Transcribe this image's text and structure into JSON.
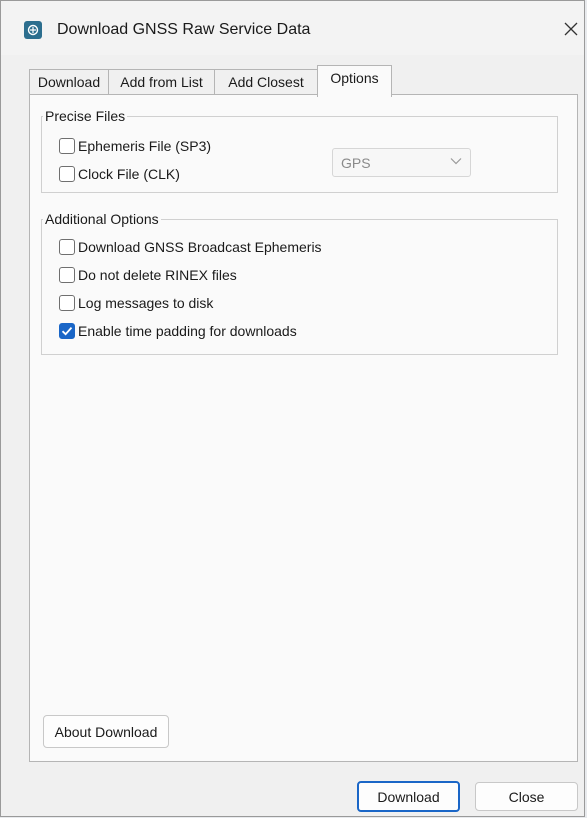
{
  "window": {
    "title": "Download GNSS Raw Service Data",
    "app_icon": "gnss-app-icon",
    "close_icon": "close-icon"
  },
  "tabs": [
    {
      "label": "Download",
      "active": false
    },
    {
      "label": "Add from List",
      "active": false
    },
    {
      "label": "Add Closest",
      "active": false
    },
    {
      "label": "Options",
      "active": true
    }
  ],
  "precise_files": {
    "legend": "Precise Files",
    "ephemeris": {
      "label": "Ephemeris File (SP3)",
      "checked": false
    },
    "clock": {
      "label": "Clock File (CLK)",
      "checked": false
    },
    "constellation": {
      "value": "GPS",
      "enabled": false
    }
  },
  "additional_options": {
    "legend": "Additional Options",
    "items": [
      {
        "label": "Download GNSS Broadcast Ephemeris",
        "checked": false
      },
      {
        "label": "Do not delete RINEX files",
        "checked": false
      },
      {
        "label": "Log messages to disk",
        "checked": false
      },
      {
        "label": "Enable time padding for downloads",
        "checked": true
      }
    ]
  },
  "buttons": {
    "about": "About Download",
    "download": "Download",
    "close": "Close"
  },
  "colors": {
    "accent": "#1a66c7",
    "window_bg": "#f0f0f0",
    "panel_bg": "#fafafa"
  }
}
